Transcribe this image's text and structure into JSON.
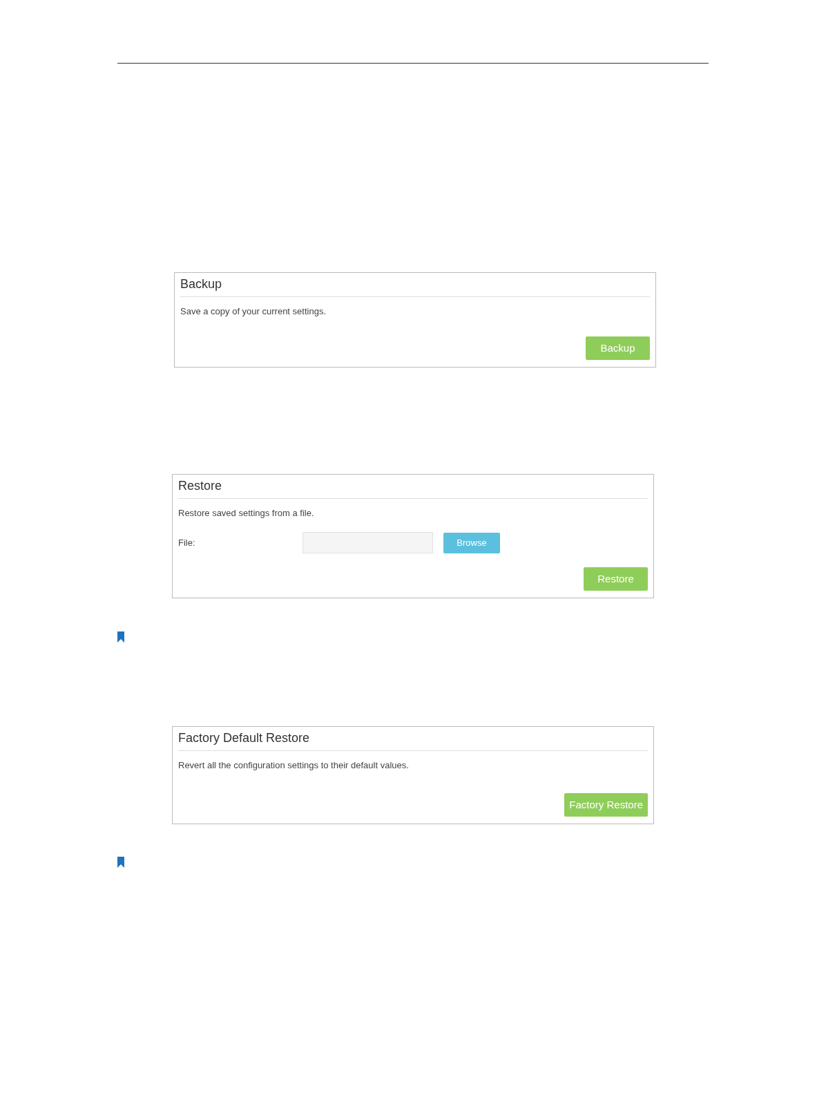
{
  "panels": [
    {
      "title": "Backup",
      "description": "Save a copy of your current settings.",
      "button": "Backup"
    },
    {
      "title": "Restore",
      "description": "Restore saved settings from a file.",
      "file": {
        "label": "File:",
        "button": "Browse"
      },
      "button": "Restore"
    },
    {
      "title": "Factory Default Restore",
      "description": "Revert all the configuration settings to their default values.",
      "button": "Factory Restore"
    }
  ]
}
